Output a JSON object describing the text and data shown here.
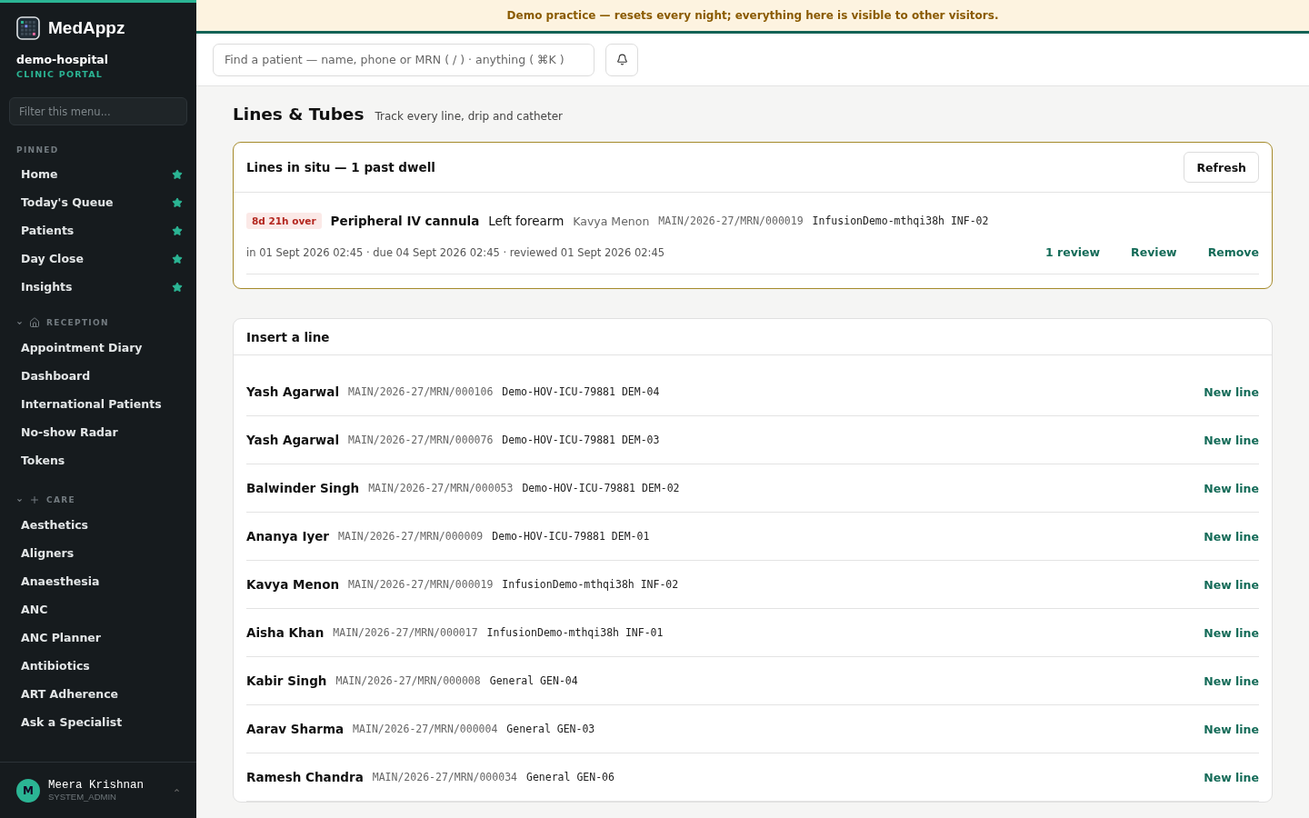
{
  "brand": {
    "name": "MedAppz",
    "org": "demo-hospital",
    "portal": "CLINIC PORTAL"
  },
  "sidebar": {
    "filter_placeholder": "Filter this menu...",
    "sections": [
      {
        "kind": "pinned",
        "title": "PINNED",
        "items": [
          "Home",
          "Today's Queue",
          "Patients",
          "Day Close",
          "Insights"
        ]
      },
      {
        "kind": "group",
        "title": "RECEPTION",
        "expanded": true,
        "items": [
          "Appointment Diary",
          "Dashboard",
          "International Patients",
          "No-show Radar",
          "Tokens"
        ]
      },
      {
        "kind": "group",
        "title": "CARE",
        "expanded": true,
        "items": [
          "Aesthetics",
          "Aligners",
          "Anaesthesia",
          "ANC",
          "ANC Planner",
          "Antibiotics",
          "ART Adherence",
          "Ask a Specialist"
        ]
      }
    ],
    "user": {
      "initial": "M",
      "name": "Meera Krishnan",
      "role": "SYSTEM_ADMIN"
    }
  },
  "banner": "Demo practice — resets every night; everything here is visible to other visitors.",
  "search": {
    "placeholder": "Find a patient — name, phone or MRN ( / ) · anything ( ⌘K )"
  },
  "page": {
    "title": "Lines & Tubes",
    "subtitle": "Track every line, drip and catheter"
  },
  "in_situ": {
    "title": "Lines in situ — 1 past dwell",
    "refresh": "Refresh",
    "lines": [
      {
        "overdue": "8d 21h over",
        "device": "Peripheral IV cannula",
        "site": "Left forearm",
        "patient": "Kavya Menon",
        "mrn": "MAIN/2026-27/MRN/000019",
        "ward": "InfusionDemo-mthqi38h INF-02",
        "times": "in 01 Sept 2026 02:45 · due 04 Sept 2026 02:45 · reviewed 01 Sept 2026 02:45",
        "actions": [
          "1 review",
          "Review",
          "Remove"
        ]
      }
    ]
  },
  "insert": {
    "title": "Insert a line",
    "rows": [
      {
        "name": "Yash Agarwal",
        "mrn": "MAIN/2026-27/MRN/000106",
        "ward": "Demo-HOV-ICU-79881 DEM-04",
        "action": "New line"
      },
      {
        "name": "Yash Agarwal",
        "mrn": "MAIN/2026-27/MRN/000076",
        "ward": "Demo-HOV-ICU-79881 DEM-03",
        "action": "New line"
      },
      {
        "name": "Balwinder Singh",
        "mrn": "MAIN/2026-27/MRN/000053",
        "ward": "Demo-HOV-ICU-79881 DEM-02",
        "action": "New line"
      },
      {
        "name": "Ananya Iyer",
        "mrn": "MAIN/2026-27/MRN/000009",
        "ward": "Demo-HOV-ICU-79881 DEM-01",
        "action": "New line"
      },
      {
        "name": "Kavya Menon",
        "mrn": "MAIN/2026-27/MRN/000019",
        "ward": "InfusionDemo-mthqi38h INF-02",
        "action": "New line"
      },
      {
        "name": "Aisha Khan",
        "mrn": "MAIN/2026-27/MRN/000017",
        "ward": "InfusionDemo-mthqi38h INF-01",
        "action": "New line"
      },
      {
        "name": "Kabir Singh",
        "mrn": "MAIN/2026-27/MRN/000008",
        "ward": "General GEN-04",
        "action": "New line"
      },
      {
        "name": "Aarav Sharma",
        "mrn": "MAIN/2026-27/MRN/000004",
        "ward": "General GEN-03",
        "action": "New line"
      },
      {
        "name": "Ramesh Chandra",
        "mrn": "MAIN/2026-27/MRN/000034",
        "ward": "General GEN-06",
        "action": "New line"
      }
    ]
  }
}
